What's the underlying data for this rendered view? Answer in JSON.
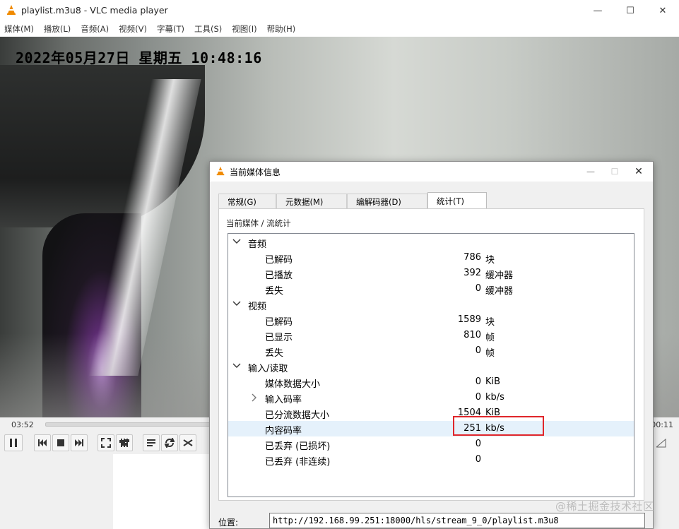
{
  "window": {
    "title": "playlist.m3u8 - VLC media player"
  },
  "menu": [
    "媒体(M)",
    "播放(L)",
    "音频(A)",
    "视频(V)",
    "字幕(T)",
    "工具(S)",
    "视图(I)",
    "帮助(H)"
  ],
  "video": {
    "osd_text": "2022年05月27日 星期五 10:48:16"
  },
  "seek": {
    "elapsed": "03:52",
    "remaining": "00:11"
  },
  "dialog": {
    "title": "当前媒体信息",
    "tabs": [
      "常规(G)",
      "元数据(M)",
      "编解码器(D)",
      "统计(T)"
    ],
    "active_tab": "统计(T)",
    "breadcrumb": "当前媒体 / 流统计",
    "sections": [
      {
        "label": "音频",
        "rows": [
          {
            "label": "已解码",
            "value": "786",
            "unit": "块"
          },
          {
            "label": "已播放",
            "value": "392",
            "unit": "缓冲器"
          },
          {
            "label": "丢失",
            "value": "0",
            "unit": "缓冲器"
          }
        ]
      },
      {
        "label": "视频",
        "rows": [
          {
            "label": "已解码",
            "value": "1589",
            "unit": "块"
          },
          {
            "label": "已显示",
            "value": "810",
            "unit": "帧"
          },
          {
            "label": "丢失",
            "value": "0",
            "unit": "帧"
          }
        ]
      },
      {
        "label": "输入/读取",
        "rows": [
          {
            "label": "媒体数据大小",
            "value": "0",
            "unit": "KiB"
          },
          {
            "label": "输入码率",
            "value": "0",
            "unit": "kb/s"
          },
          {
            "label": "已分流数据大小",
            "value": "1504",
            "unit": "KiB"
          },
          {
            "label": "内容码率",
            "value": "251",
            "unit": "kb/s"
          },
          {
            "label": "已丢弃 (已损坏)",
            "value": "0",
            "unit": ""
          },
          {
            "label": "已丢弃 (非连续)",
            "value": "0",
            "unit": ""
          }
        ]
      }
    ],
    "location_label": "位置:",
    "location_value": "http://192.168.99.251:18000/hls/stream_9_0/playlist.m3u8"
  },
  "watermark": "@稀土掘金技术社区",
  "colors": {
    "highlight_box": "#e0262b",
    "selected_row": "#e5f1fb",
    "vlc_orange": "#f08a00"
  }
}
